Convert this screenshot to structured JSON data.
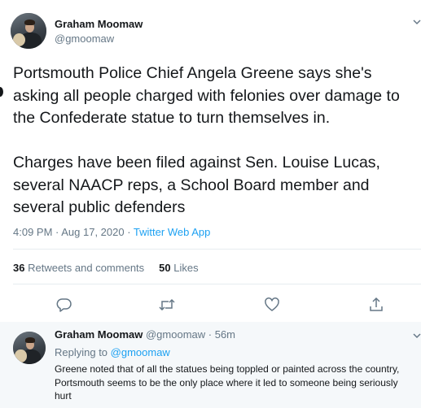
{
  "tweet": {
    "author_name": "Graham Moomaw",
    "author_handle": "@gmoomaw",
    "text": "Portsmouth Police Chief Angela Greene says she's asking all people charged with felonies over damage to the Confederate statue to turn themselves in.\n\nCharges have been filed against Sen. Louise Lucas, several NAACP reps, a School Board member and several public defenders",
    "time": "4:09 PM · Aug 17, 2020 · ",
    "source_app": "Twitter Web App",
    "retweets_count": "36",
    "retweets_label": "Retweets and comments",
    "likes_count": "50",
    "likes_label": "Likes"
  },
  "actions": {
    "reply_icon": "speech-bubble",
    "retweet_icon": "retweet-arrows",
    "like_icon": "heart",
    "share_icon": "share-up-arrow"
  },
  "reply": {
    "author_name": "Graham Moomaw",
    "author_handle": "@gmoomaw",
    "separator": " · ",
    "time_ago": "56m",
    "replying_to_label": "Replying to ",
    "replying_to_handle": "@gmoomaw",
    "text": "Greene noted that of all the statues being toppled or painted across the country, Portsmouth seems to be the only place where it led to someone being seriously hurt"
  },
  "colors": {
    "accent": "#1da1f2",
    "secondary_text": "#657786",
    "primary_text": "#14171a",
    "reply_background": "#f5f8fa"
  }
}
